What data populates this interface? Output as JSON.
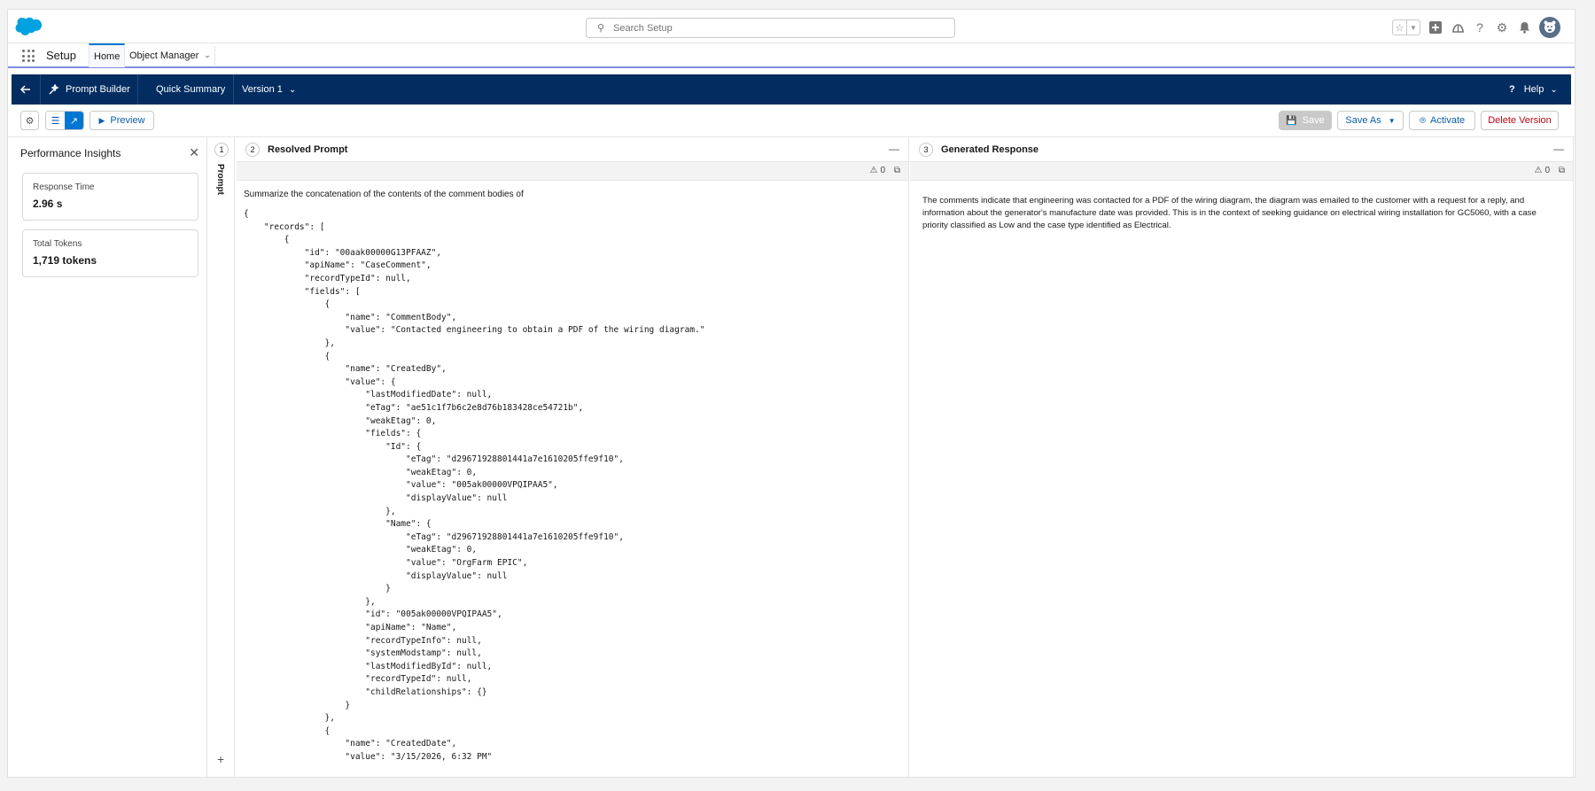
{
  "header": {
    "search_placeholder": "Search Setup"
  },
  "context_bar": {
    "app_name": "Setup",
    "tabs": [
      {
        "label": "Home"
      },
      {
        "label": "Object Manager"
      }
    ]
  },
  "builder_bar": {
    "app": "Prompt Builder",
    "template_name": "Quick Summary",
    "version": "Version 1",
    "help": "Help"
  },
  "toolbar": {
    "preview": "Preview",
    "save": "Save",
    "save_as": "Save As",
    "activate": "Activate",
    "delete_version": "Delete Version"
  },
  "insights": {
    "title": "Performance Insights",
    "metrics": [
      {
        "label": "Response Time",
        "value": "2.96 s"
      },
      {
        "label": "Total Tokens",
        "value": "1,719 tokens"
      }
    ]
  },
  "steps": {
    "prompt": {
      "number": "1",
      "label": "Prompt"
    },
    "resolved": {
      "number": "2",
      "title": "Resolved Prompt",
      "warnings": "0"
    },
    "generated": {
      "number": "3",
      "title": "Generated Response",
      "warnings": "0"
    }
  },
  "resolved_prompt": {
    "intro": "Summarize the concatenation of the contents of the comment bodies of",
    "json_lines": [
      "{",
      "    \"records\": [",
      "        {",
      "            \"id\": \"00aak00000G13PFAAZ\",",
      "            \"apiName\": \"CaseComment\",",
      "            \"recordTypeId\": null,",
      "            \"fields\": [",
      "                {",
      "                    \"name\": \"CommentBody\",",
      "                    \"value\": \"Contacted engineering to obtain a PDF of the wiring diagram.\"",
      "                },",
      "                {",
      "                    \"name\": \"CreatedBy\",",
      "                    \"value\": {",
      "                        \"lastModifiedDate\": null,",
      "                        \"eTag\": \"ae51c1f7b6c2e8d76b183428ce54721b\",",
      "                        \"weakEtag\": 0,",
      "                        \"fields\": {",
      "                            \"Id\": {",
      "                                \"eTag\": \"d29671928801441a7e1610205ffe9f10\",",
      "                                \"weakEtag\": 0,",
      "                                \"value\": \"005ak00000VPQIPAA5\",",
      "                                \"displayValue\": null",
      "                            },",
      "                            \"Name\": {",
      "                                \"eTag\": \"d29671928801441a7e1610205ffe9f10\",",
      "                                \"weakEtag\": 0,",
      "                                \"value\": \"OrgFarm EPIC\",",
      "                                \"displayValue\": null",
      "                            }",
      "                        },",
      "                        \"id\": \"005ak00000VPQIPAA5\",",
      "                        \"apiName\": \"Name\",",
      "                        \"recordTypeInfo\": null,",
      "                        \"systemModstamp\": null,",
      "                        \"lastModifiedById\": null,",
      "                        \"recordTypeId\": null,",
      "                        \"childRelationships\": {}",
      "                    }",
      "                },",
      "                {",
      "                    \"name\": \"CreatedDate\",",
      "                    \"value\": \"3/15/2026, 6:32 PM\""
    ]
  },
  "generated_response": {
    "text": "The comments indicate that engineering was contacted for a PDF of the wiring diagram, the diagram was emailed to the customer with a request for a reply, and information about the generator's manufacture date was provided. This is in the context of seeking guidance on electrical wiring installation for GC5060, with a case priority classified as Low and the case type identified as Electrical."
  },
  "colors": {
    "brand_navy": "#032d60",
    "brand_blue": "#0176d3",
    "salesforce_cloud": "#00a1e0",
    "danger": "#ba0517"
  }
}
